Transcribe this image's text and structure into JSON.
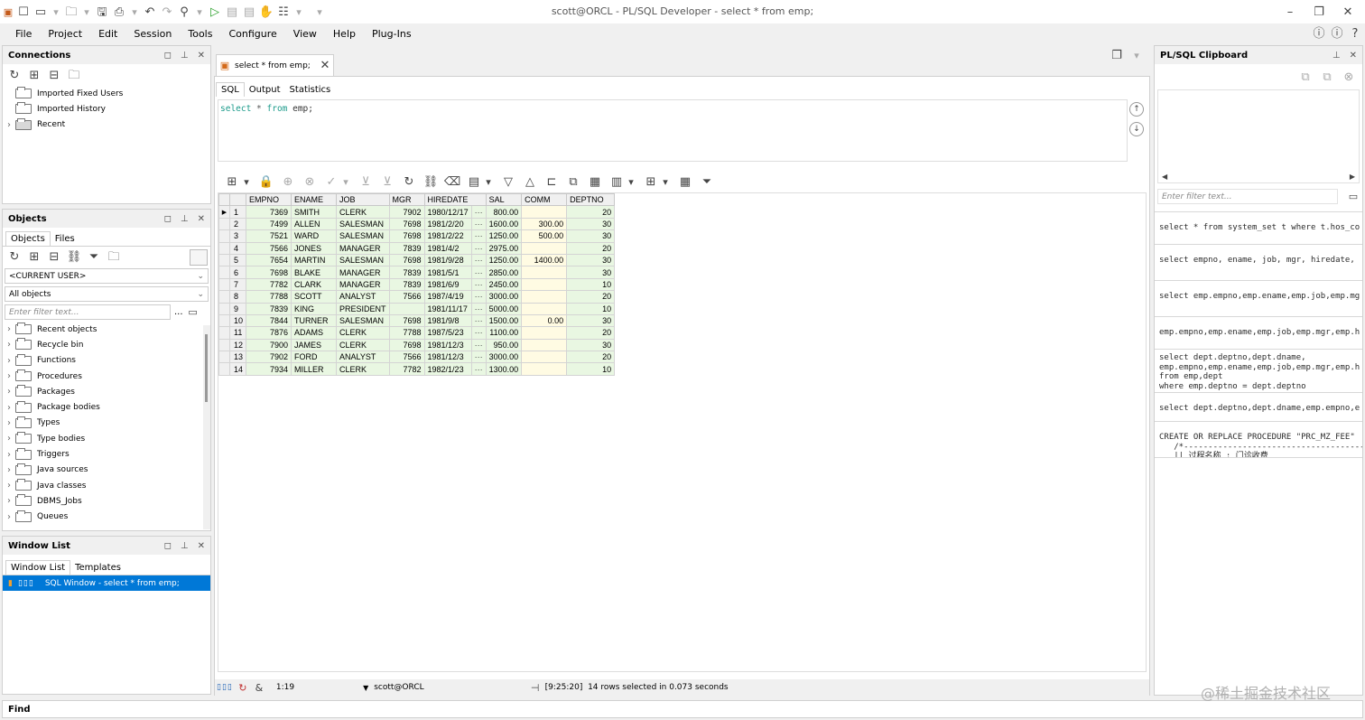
{
  "app": {
    "title": "scott@ORCL - PL/SQL Developer - select * from emp;"
  },
  "menu": [
    "File",
    "Project",
    "Edit",
    "Session",
    "Tools",
    "Configure",
    "View",
    "Help",
    "Plug-Ins"
  ],
  "connections": {
    "title": "Connections",
    "items": [
      "Imported Fixed Users",
      "Imported History",
      "Recent"
    ]
  },
  "objects": {
    "title": "Objects",
    "tabs": [
      "Objects",
      "Files"
    ],
    "user": "<CURRENT USER>",
    "filter": "All objects",
    "filter_placeholder": "Enter filter text...",
    "more": "...",
    "items": [
      "Recent objects",
      "Recycle bin",
      "Functions",
      "Procedures",
      "Packages",
      "Package bodies",
      "Types",
      "Type bodies",
      "Triggers",
      "Java sources",
      "Java classes",
      "DBMS_Jobs",
      "Queues"
    ]
  },
  "windowlist": {
    "title": "Window List",
    "tabs": [
      "Window List",
      "Templates"
    ],
    "item": "SQL Window - select * from emp;"
  },
  "editor": {
    "tab": "select * from emp;",
    "subtabs": [
      "SQL",
      "Output",
      "Statistics"
    ],
    "sql": {
      "kw1": "select",
      "star": " * ",
      "kw2": "from",
      "rest": " emp;"
    }
  },
  "grid": {
    "columns": [
      "EMPNO",
      "ENAME",
      "JOB",
      "MGR",
      "HIREDATE",
      "SAL",
      "COMM",
      "DEPTNO"
    ],
    "rows": [
      [
        "1",
        "7369",
        "SMITH",
        "CLERK",
        "7902",
        "1980/12/17",
        "800.00",
        "",
        "20"
      ],
      [
        "2",
        "7499",
        "ALLEN",
        "SALESMAN",
        "7698",
        "1981/2/20",
        "1600.00",
        "300.00",
        "30"
      ],
      [
        "3",
        "7521",
        "WARD",
        "SALESMAN",
        "7698",
        "1981/2/22",
        "1250.00",
        "500.00",
        "30"
      ],
      [
        "4",
        "7566",
        "JONES",
        "MANAGER",
        "7839",
        "1981/4/2",
        "2975.00",
        "",
        "20"
      ],
      [
        "5",
        "7654",
        "MARTIN",
        "SALESMAN",
        "7698",
        "1981/9/28",
        "1250.00",
        "1400.00",
        "30"
      ],
      [
        "6",
        "7698",
        "BLAKE",
        "MANAGER",
        "7839",
        "1981/5/1",
        "2850.00",
        "",
        "30"
      ],
      [
        "7",
        "7782",
        "CLARK",
        "MANAGER",
        "7839",
        "1981/6/9",
        "2450.00",
        "",
        "10"
      ],
      [
        "8",
        "7788",
        "SCOTT",
        "ANALYST",
        "7566",
        "1987/4/19",
        "3000.00",
        "",
        "20"
      ],
      [
        "9",
        "7839",
        "KING",
        "PRESIDENT",
        "",
        "1981/11/17",
        "5000.00",
        "",
        "10"
      ],
      [
        "10",
        "7844",
        "TURNER",
        "SALESMAN",
        "7698",
        "1981/9/8",
        "1500.00",
        "0.00",
        "30"
      ],
      [
        "11",
        "7876",
        "ADAMS",
        "CLERK",
        "7788",
        "1987/5/23",
        "1100.00",
        "",
        "20"
      ],
      [
        "12",
        "7900",
        "JAMES",
        "CLERK",
        "7698",
        "1981/12/3",
        "950.00",
        "",
        "30"
      ],
      [
        "13",
        "7902",
        "FORD",
        "ANALYST",
        "7566",
        "1981/12/3",
        "3000.00",
        "",
        "20"
      ],
      [
        "14",
        "7934",
        "MILLER",
        "CLERK",
        "7782",
        "1982/1/23",
        "1300.00",
        "",
        "10"
      ]
    ],
    "dots": "···"
  },
  "status": {
    "pos": "1:19",
    "conn": "scott@ORCL",
    "msg": "[9:25:20]  14 rows selected in 0.073 seconds"
  },
  "clipboard": {
    "title": "PL/SQL Clipboard",
    "filter_placeholder": "Enter filter text...",
    "entries": [
      "select * from system_set t where t.hos_co",
      "select empno, ename, job, mgr, hiredate,",
      "select emp.empno,emp.ename,emp.job,emp.mg",
      "emp.empno,emp.ename,emp.job,emp.mgr,emp.h",
      "select dept.deptno,dept.dname,\nemp.empno,emp.ename,emp.job,emp.mgr,emp.h\nfrom emp,dept\nwhere emp.deptno = dept.deptno",
      "select dept.deptno,dept.dname,emp.empno,e",
      "CREATE OR REPLACE PROCEDURE \"PRC_MZ_FEE\"\n   /*--------------------------------------\n   || 过程名称 : 门诊收费\n   || 功能描述 : 将录入的项目转发票代码/"
    ]
  },
  "find": {
    "label": "Find"
  },
  "watermark": "@稀土掘金技术社区"
}
